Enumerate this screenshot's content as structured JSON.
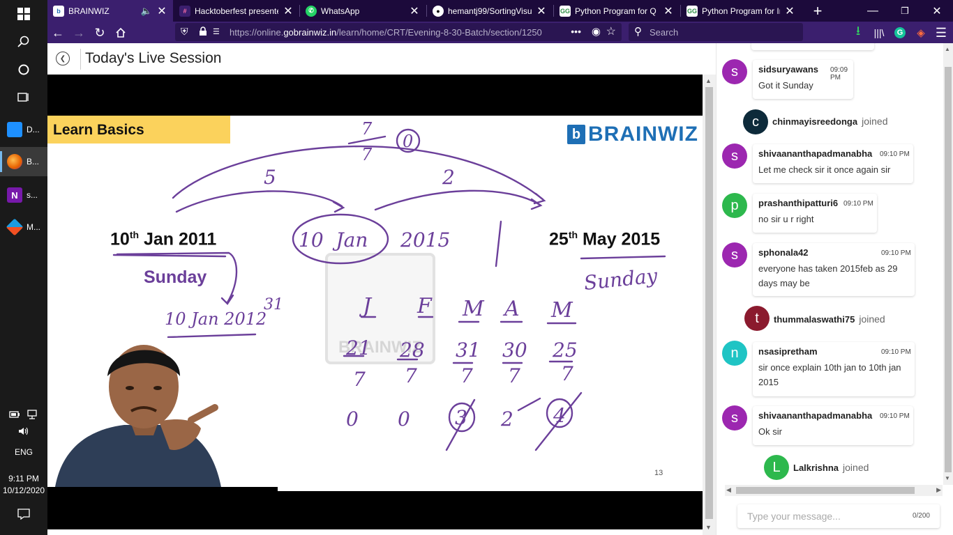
{
  "taskbar": {
    "apps": [
      {
        "label": "D...",
        "color": "#1e90ff"
      },
      {
        "label": "B...",
        "color": "#e66000"
      },
      {
        "label": "s...",
        "color": "#7719aa"
      },
      {
        "label": "M...",
        "color": "#1b9ce2"
      }
    ],
    "language": "ENG",
    "time": "9:11 PM",
    "date": "10/12/2020"
  },
  "tabs": [
    {
      "title": "BRAINWIZ",
      "active": true
    },
    {
      "title": "Hacktoberfest presente",
      "active": false
    },
    {
      "title": "WhatsApp",
      "active": false
    },
    {
      "title": "hemantj99/SortingVisu",
      "active": false
    },
    {
      "title": "Python Program for Q",
      "active": false
    },
    {
      "title": "Python Program for In",
      "active": false
    }
  ],
  "address": {
    "prefix": "https://online.",
    "domain": "gobrainwiz.in",
    "path": "/learn/home/CRT/Evening-8-30-Batch/section/1250",
    "search_placeholder": "Search"
  },
  "session": {
    "title": "Today's Live Session"
  },
  "slide": {
    "banner": "Learn Basics",
    "brand": "BRAINWIZ",
    "watermark": "BRAINWIZ",
    "date_left_day": "10",
    "date_left_sup": "th",
    "date_left_rest": " Jan 2011",
    "date_right_day": "25",
    "date_right_sup": "th",
    "date_right_rest": " May 2015",
    "day_left": "Sunday",
    "page_number": "13",
    "hand": {
      "top_fraction_num": "7",
      "top_fraction_den": "7",
      "top_remainder": "0",
      "arc_left": "5",
      "arc_right": "2",
      "circled_date": "10  Jan",
      "year": "2015",
      "sunday": "Sunday",
      "jan_2012": "10 Jan 2012",
      "days_31": "31",
      "months": [
        "J",
        "F",
        "M",
        "A",
        "M"
      ],
      "days": [
        "21",
        "28",
        "31",
        "30",
        "25"
      ],
      "divisor": "7",
      "remainders": [
        "0",
        "0",
        "3",
        "2",
        "4"
      ]
    }
  },
  "chat": {
    "messages": [
      {
        "initial": "s",
        "color": "#9c27b0",
        "user": "sidsuryawans",
        "time": "09:09 PM",
        "text": "Got it Sunday"
      },
      {
        "initial": "s",
        "color": "#9c27b0",
        "user": "shivaananthapadmanabha",
        "time": "09:10 PM",
        "text": "Let me check sir it once again sir"
      },
      {
        "initial": "p",
        "color": "#2db84d",
        "user": "prashanthipatturi6",
        "time": "09:10 PM",
        "text": "no sir u r right"
      },
      {
        "initial": "s",
        "color": "#9c27b0",
        "user": "sphonala42",
        "time": "09:10 PM",
        "text": "everyone has taken 2015feb as 29 days may be"
      },
      {
        "initial": "n",
        "color": "#1fc4c4",
        "user": "nsasipretham",
        "time": "09:10 PM",
        "text": "sir once explain 10th jan to 10th jan 2015"
      },
      {
        "initial": "s",
        "color": "#9c27b0",
        "user": "shivaananthapadmanabha",
        "time": "09:10 PM",
        "text": "Ok sir"
      }
    ],
    "joins": [
      {
        "initial": "c",
        "color": "#0d2a3a",
        "user": "chinmayisreedonga",
        "label": "joined"
      },
      {
        "initial": "t",
        "color": "#8b1a2e",
        "user": "thummalaswathi75",
        "label": "joined"
      },
      {
        "initial": "L",
        "color": "#2db84d",
        "user": "Lalkrishna",
        "label": "joined"
      }
    ],
    "input_placeholder": "Type your message...",
    "char_count": "0/200"
  }
}
